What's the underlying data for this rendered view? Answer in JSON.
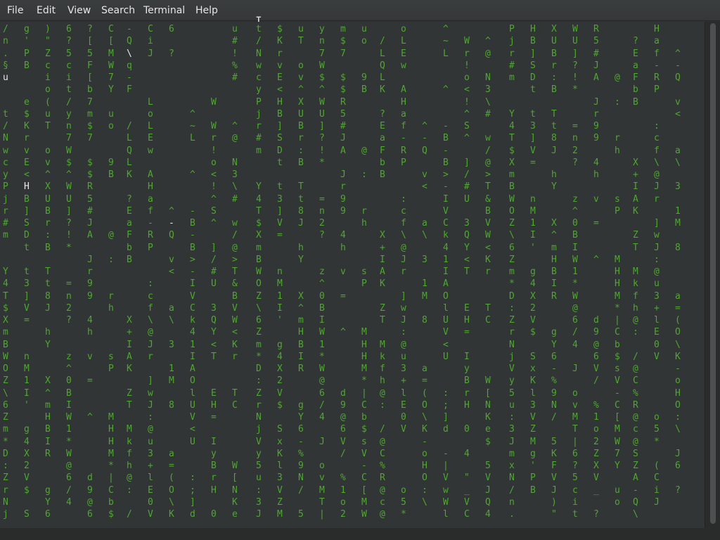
{
  "menu": {
    "items": [
      "File",
      "Edit",
      "View",
      "Search",
      "Terminal",
      "Help"
    ]
  },
  "colors": {
    "rain_green": "#4fa82f",
    "rain_white": "#e8e8e8",
    "background": "#313536"
  },
  "mouse_cursor": {
    "icon": "i-beam-cursor-icon"
  },
  "terminal": {
    "columns": [
      {
        "text": "/n.§u  t/NwcyPjr#m  Y4T$XmBWOZ\\6Zm*D:ZrNjVy5u:3JmxN",
        "white": {
          "4": 1
        }
      },
      {
        "text": "g'PB  e$KrvE<HB]SDt t3]V=  nM1I' g4X2V$ SxKl3VZM",
        "white": {
          "13": 1
        }
      },
      {
        "text": ")\"Zcio(uT ov^XUBr:B Tt8J hY  X^mHBIR  gY6-%9N/ 5KFVJ",
        "white": {}
      },
      {
        "text": "6?5cit/yn7W$^WU]?!*  =n2?  z^0BIW1*W@6/4 J ovMT|",
        "white": {}
      },
      {
        "text": "?[5F[b7m$7 $$R5#JA Jr99 4h v =  ^    d9@6V/ %1o2ZXV_ ",
        "white": {}
      },
      {
        "text": "C[MW7Y uo  9B    @ :  rh   sP   MHHM*|Cb$sV-",
        "white": {}
      },
      {
        "text": "-Q\\q-F  /LQLK ?EaFbB    X+IAK ZT Mkfh@: /@C%R@c@SZA",
        "white": {
          "2": 1
        }
      },
      {
        "text": "CiJ   LoLEw AHaf-RP  :cf\\@Jr ]wJ:@u3+lE0V    o5* (",
        "white": {}
      },
      {
        "text": "6 ?            ^-Q v<  a\\ 3 1M 8   a=(O\\K-oHO:\\ J",
        "white": {
          "16": 1
        }
      },
      {
        "text": "       ^~L  ^  -B-B>-IVCk41IAOlUV<U  :;]d -|VwWlR=o~  <",
        "white": {}
      },
      {
        "text": "      W Wr!o<!^S^ ]/#U 3QY<T  EH= IyBrH 0 4 \"_VC",
        "white": {}
      },
      {
        "text": "u#!%#   ^@ N3\\# w/@>T&BVW<Kr  TC    W[NKe$ 5VJQ4  ",
        "white": {}
      }
    ]
  }
}
